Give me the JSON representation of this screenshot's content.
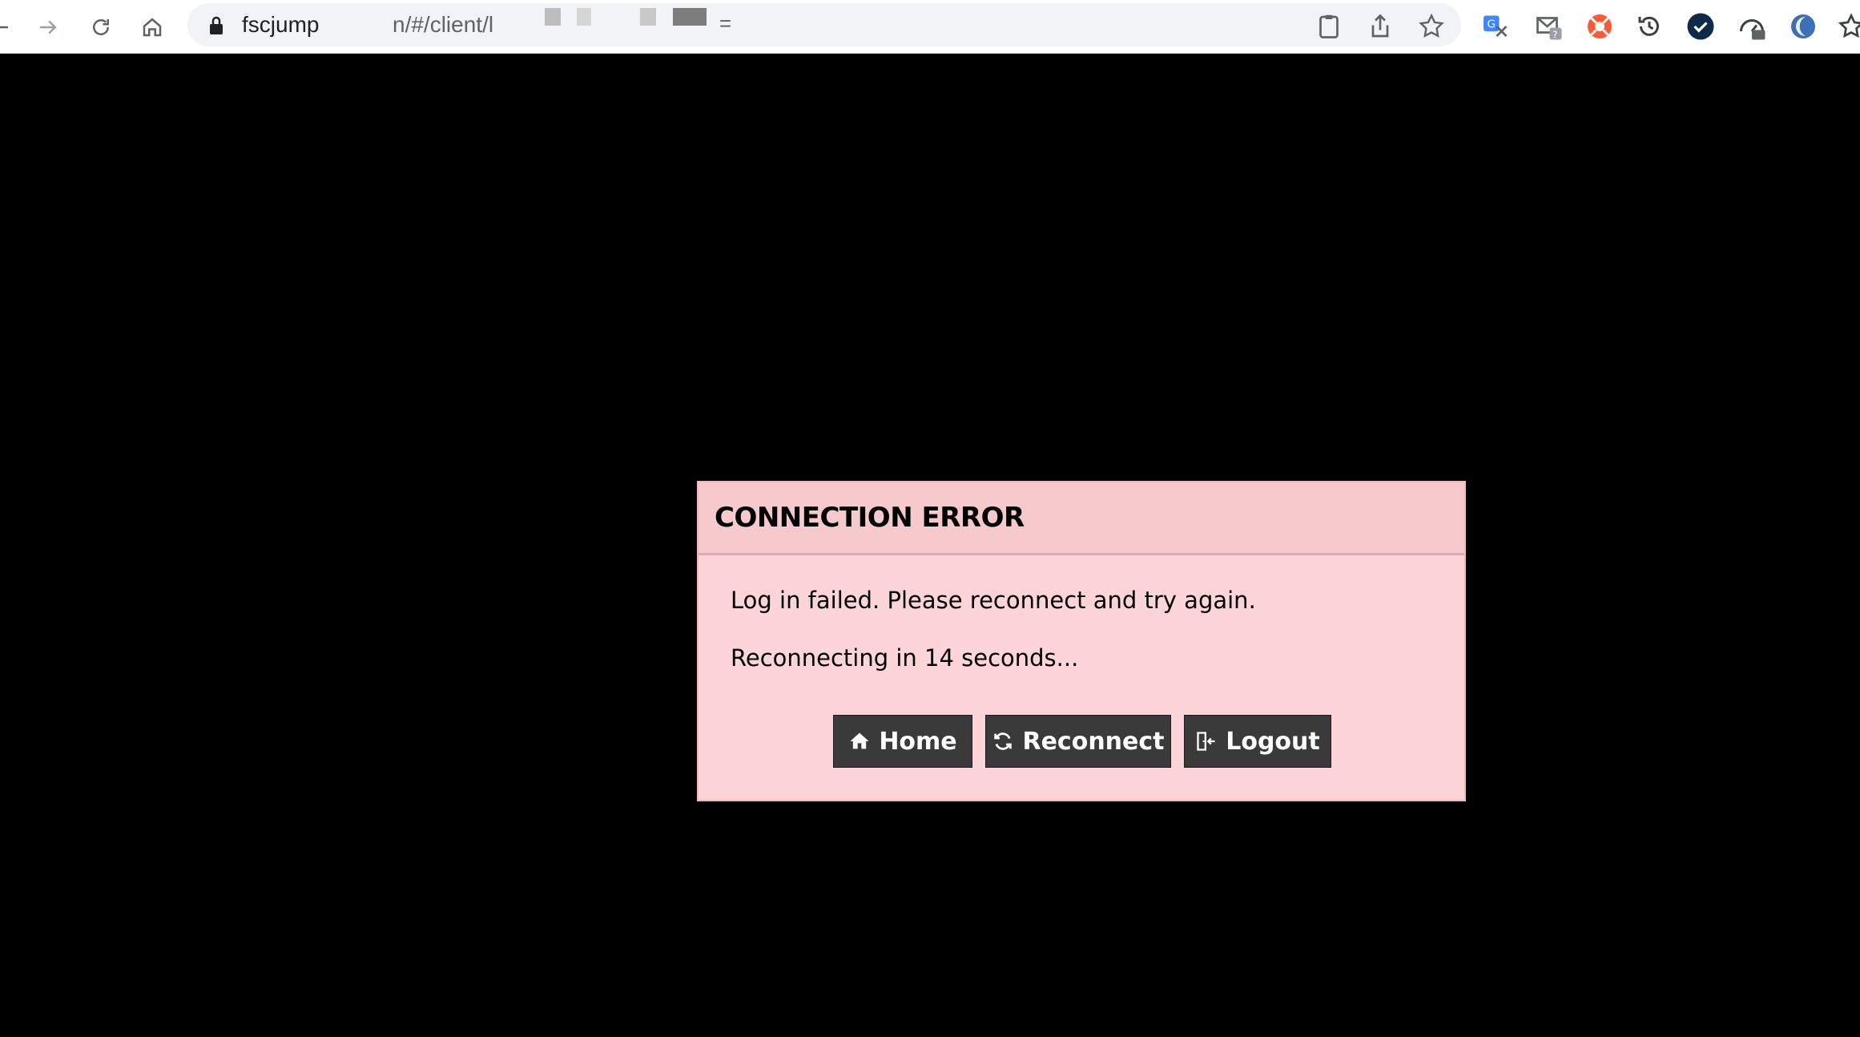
{
  "browser": {
    "url_host": "fscjump",
    "url_path": "n/#/client/l",
    "url_suffix": "=",
    "nav": {
      "back_icon": "back-arrow-icon",
      "forward_icon": "forward-arrow-icon",
      "reload_icon": "reload-icon",
      "home_icon": "home-icon"
    },
    "toolbar_icons": [
      "clipboard-icon",
      "share-icon",
      "bookmark-star-icon"
    ],
    "extensions": [
      "translate-extension-icon",
      "mail-extension-icon",
      "lifebuoy-extension-icon",
      "history-extension-icon",
      "checkmark-extension-icon",
      "speed-extension-icon",
      "moon-extension-icon",
      "star-extension-icon"
    ]
  },
  "dialog": {
    "title": "CONNECTION ERROR",
    "message": "Log in failed. Please reconnect and try again.",
    "countdown": "Reconnecting in 14 seconds...",
    "buttons": {
      "home": "Home",
      "reconnect": "Reconnect",
      "logout": "Logout"
    }
  },
  "colors": {
    "page_background": "#000000",
    "dialog_background": "#fdd5d8",
    "dialog_header": "#f6c9cd",
    "button_background": "#3a3a3a",
    "button_text": "#ffffff"
  }
}
